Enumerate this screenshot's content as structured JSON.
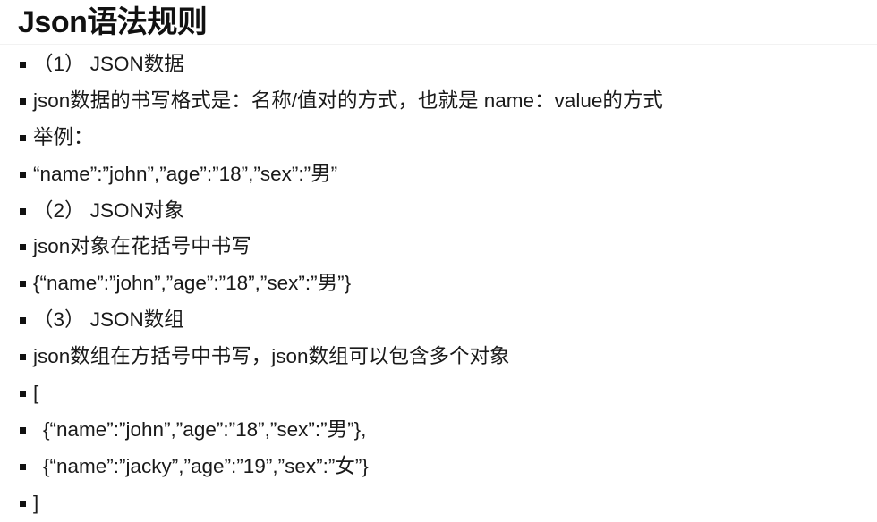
{
  "slide": {
    "title": "Json语法规则",
    "bullets": [
      {
        "text": "（1） JSON数据",
        "indent": false
      },
      {
        "text": "json数据的书写格式是：名称/值对的方式，也就是 name：value的方式",
        "indent": false
      },
      {
        "text": "举例：",
        "indent": false
      },
      {
        "text": "“name”:”john”,”age”:”18”,”sex”:”男”",
        "indent": false
      },
      {
        "text": "（2） JSON对象",
        "indent": false
      },
      {
        "text": "json对象在花括号中书写",
        "indent": false
      },
      {
        "text": "{“name”:”john”,”age”:”18”,”sex”:”男”}",
        "indent": false
      },
      {
        "text": "（3） JSON数组",
        "indent": false
      },
      {
        "text": "json数组在方括号中书写，json数组可以包含多个对象",
        "indent": false
      },
      {
        "text": "[",
        "indent": false
      },
      {
        "text": "{“name”:”john”,”age”:”18”,”sex”:”男”},",
        "indent": true
      },
      {
        "text": "{“name”:”jacky”,”age”:”19”,”sex”:”女”}",
        "indent": true
      },
      {
        "text": "]",
        "indent": false
      }
    ]
  }
}
